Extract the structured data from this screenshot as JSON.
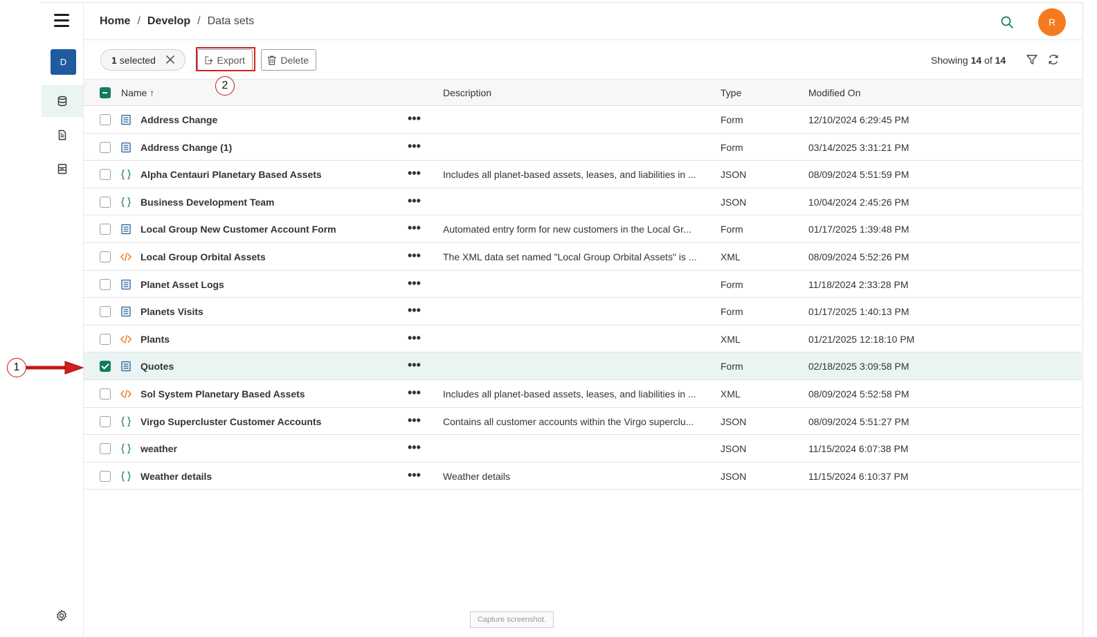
{
  "rail": {
    "avatar_letter": "D"
  },
  "breadcrumb": {
    "home": "Home",
    "develop": "Develop",
    "current": "Data sets",
    "sep": "/"
  },
  "user": {
    "initial": "R"
  },
  "toolbar": {
    "selected_count": "1",
    "selected_label": "selected",
    "export_label": "Export",
    "delete_label": "Delete",
    "showing_prefix": "Showing",
    "showing_count": "14",
    "showing_of": "of",
    "showing_total": "14"
  },
  "columns": {
    "name": "Name",
    "sort_indicator": "↑",
    "description": "Description",
    "type": "Type",
    "modified": "Modified On"
  },
  "rows": [
    {
      "name": "Address Change",
      "description": "",
      "type": "Form",
      "modified": "12/10/2024 6:29:45 PM",
      "icon": "form-icon",
      "checked": false
    },
    {
      "name": "Address Change (1)",
      "description": "",
      "type": "Form",
      "modified": "03/14/2025 3:31:21 PM",
      "icon": "form-icon",
      "checked": false
    },
    {
      "name": "Alpha Centauri Planetary Based Assets",
      "description": "Includes all planet-based assets, leases, and liabilities in ...",
      "type": "JSON",
      "modified": "08/09/2024 5:51:59 PM",
      "icon": "json-icon",
      "checked": false
    },
    {
      "name": "Business Development Team",
      "description": "",
      "type": "JSON",
      "modified": "10/04/2024 2:45:26 PM",
      "icon": "json-icon",
      "checked": false
    },
    {
      "name": "Local Group New Customer Account Form",
      "description": "Automated entry form for new customers in the Local Gr...",
      "type": "Form",
      "modified": "01/17/2025 1:39:48 PM",
      "icon": "form-icon",
      "checked": false
    },
    {
      "name": "Local Group Orbital Assets",
      "description": "The XML data set named \"Local Group Orbital Assets\" is ...",
      "type": "XML",
      "modified": "08/09/2024 5:52:26 PM",
      "icon": "xml-icon",
      "checked": false
    },
    {
      "name": "Planet Asset Logs",
      "description": "",
      "type": "Form",
      "modified": "11/18/2024 2:33:28 PM",
      "icon": "form-icon",
      "checked": false
    },
    {
      "name": "Planets Visits",
      "description": "",
      "type": "Form",
      "modified": "01/17/2025 1:40:13 PM",
      "icon": "form-icon",
      "checked": false
    },
    {
      "name": "Plants",
      "description": "",
      "type": "XML",
      "modified": "01/21/2025 12:18:10 PM",
      "icon": "xml-icon",
      "checked": false
    },
    {
      "name": "Quotes",
      "description": "",
      "type": "Form",
      "modified": "02/18/2025 3:09:58 PM",
      "icon": "form-icon",
      "checked": true
    },
    {
      "name": "Sol System Planetary Based Assets",
      "description": "Includes all planet-based assets, leases, and liabilities in ...",
      "type": "XML",
      "modified": "08/09/2024 5:52:58 PM",
      "icon": "xml-icon",
      "checked": false
    },
    {
      "name": "Virgo Supercluster Customer Accounts",
      "description": "Contains all customer accounts within the Virgo superclu...",
      "type": "JSON",
      "modified": "08/09/2024 5:51:27 PM",
      "icon": "json-icon",
      "checked": false
    },
    {
      "name": "weather",
      "description": "",
      "type": "JSON",
      "modified": "11/15/2024 6:07:38 PM",
      "icon": "json-icon",
      "checked": false
    },
    {
      "name": "Weather details",
      "description": "Weather details",
      "type": "JSON",
      "modified": "11/15/2024 6:10:37 PM",
      "icon": "json-icon",
      "checked": false
    }
  ],
  "row_menu_glyph": "•••",
  "annotations": {
    "step1": "1",
    "step2": "2"
  },
  "capture_label": "Capture screenshot.",
  "colors": {
    "accent": "#137a5e",
    "brand": "#1f5b9e",
    "user": "#f47a1f",
    "form_icon": "#1f5b9e",
    "json_icon": "#2e8b57",
    "xml_icon": "#f07a1a",
    "annotation": "#c01818"
  }
}
